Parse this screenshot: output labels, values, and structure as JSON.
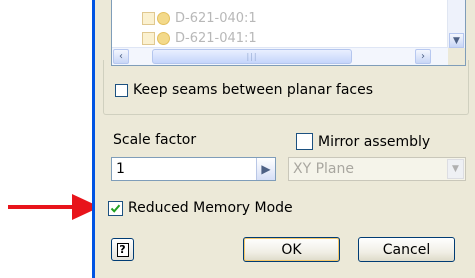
{
  "tree": {
    "items": [
      {
        "label": "D-621-040:1"
      },
      {
        "label": "D-621-041:1"
      }
    ]
  },
  "options": {
    "keep_seams_label": "Keep seams between planar faces",
    "keep_seams_checked": false,
    "scale_factor_label": "Scale factor",
    "scale_factor_value": "1",
    "mirror_assembly_label": "Mirror assembly",
    "mirror_assembly_checked": false,
    "mirror_plane_value": "XY Plane",
    "reduced_memory_label": "Reduced Memory Mode",
    "reduced_memory_checked": true
  },
  "buttons": {
    "help_label": "?",
    "ok_label": "OK",
    "cancel_label": "Cancel"
  },
  "colors": {
    "annotation_arrow": "#e8141b",
    "dialog_bg": "#ece9d8",
    "window_frame": "#0054e3"
  },
  "icons": {
    "arrow": "annotation-arrow-icon",
    "scroll_down": "scroll-down-icon",
    "scroll_left": "scroll-left-icon",
    "scroll_right": "scroll-right-icon",
    "go": "chevron-right-icon",
    "dropdown": "chevron-down-icon",
    "checkmark": "checkmark-icon"
  }
}
